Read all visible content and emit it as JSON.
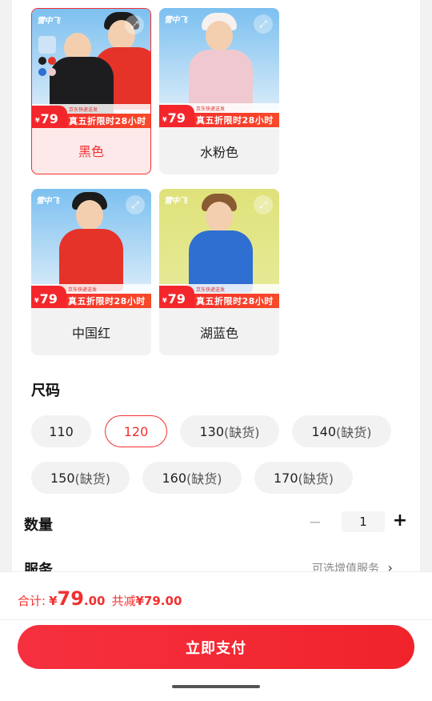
{
  "colors": {
    "accent": "#f23030",
    "selected_bg": "#fde9ea",
    "pill_bg": "#f2f2f2"
  },
  "product": {
    "brand_text": "雪中飞",
    "promo_price": "79",
    "promo_currency": "¥",
    "promo_banner": "真五折限时28小时",
    "promo_small": "京东快递送发"
  },
  "color_options": [
    {
      "label": "黑色",
      "selected": true,
      "jacket": "#1d1d1f"
    },
    {
      "label": "水粉色",
      "selected": false,
      "jacket": "#efc9cf"
    },
    {
      "label": "中国红",
      "selected": false,
      "jacket": "#e5332a"
    },
    {
      "label": "湖蓝色",
      "selected": false,
      "jacket": "#2f6fd1"
    }
  ],
  "size_section": {
    "title": "尺码",
    "options": [
      {
        "size": "110",
        "note": "",
        "selected": false
      },
      {
        "size": "120",
        "note": "",
        "selected": true
      },
      {
        "size": "130",
        "note": "(缺货)",
        "selected": false
      },
      {
        "size": "140",
        "note": "(缺货)",
        "selected": false
      },
      {
        "size": "150",
        "note": "(缺货)",
        "selected": false
      },
      {
        "size": "160",
        "note": "(缺货)",
        "selected": false
      },
      {
        "size": "170",
        "note": "(缺货)",
        "selected": false
      }
    ]
  },
  "quantity": {
    "title": "数量",
    "value": "1",
    "minus_icon": "minus-icon",
    "plus_icon": "plus-icon"
  },
  "service": {
    "title": "服务",
    "hint": "可选增值服务",
    "chevron": "›"
  },
  "footer": {
    "total_label": "合计:",
    "currency": "¥",
    "price_int": "79",
    "price_dec": ".00",
    "savings_label": "共减",
    "savings_value": "¥79.00",
    "pay_label": "立即支付"
  }
}
